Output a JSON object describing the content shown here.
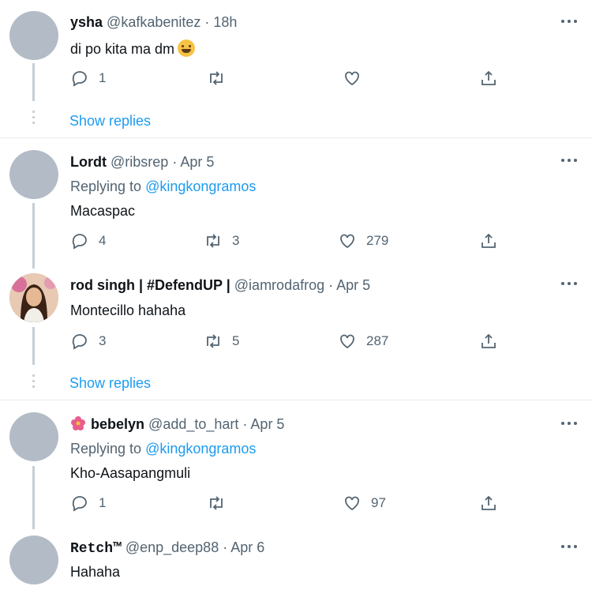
{
  "tweets": [
    {
      "name": "ysha",
      "handle": "@kafkabenitez",
      "time": "· 18h",
      "text": "di po kita ma dm",
      "reply": "1",
      "retweet": "",
      "like": ""
    },
    {
      "name": "Lordt",
      "handle": "@ribsrep",
      "time": "· Apr 5",
      "replying_prefix": "Replying to",
      "replying_to": "@kingkongramos",
      "text": "Macaspac",
      "reply": "4",
      "retweet": "3",
      "like": "279"
    },
    {
      "name": "rod singh | #DefendUP |",
      "handle": "@iamrodafrog",
      "time": "· Apr 5",
      "text": "Montecillo hahaha",
      "reply": "3",
      "retweet": "5",
      "like": "287"
    },
    {
      "name": "bebelyn",
      "handle": "@add_to_hart",
      "time": "· Apr 5",
      "replying_prefix": "Replying to",
      "replying_to": "@kingkongramos",
      "text": "Kho-Aasapangmuli",
      "reply": "1",
      "retweet": "",
      "like": "97"
    },
    {
      "name": "Retch™",
      "handle": "@enp_deep88",
      "time": "· Apr 6",
      "text": "Hahaha"
    }
  ],
  "show_replies": "Show replies",
  "icons": [
    "more-icon",
    "reply-icon",
    "retweet-icon",
    "like-icon",
    "share-icon",
    "emoji-icon",
    "flower-icon"
  ],
  "colors": {
    "link": "#1d9bf0",
    "muted": "#536471",
    "avatar": "#b3bcc6"
  }
}
